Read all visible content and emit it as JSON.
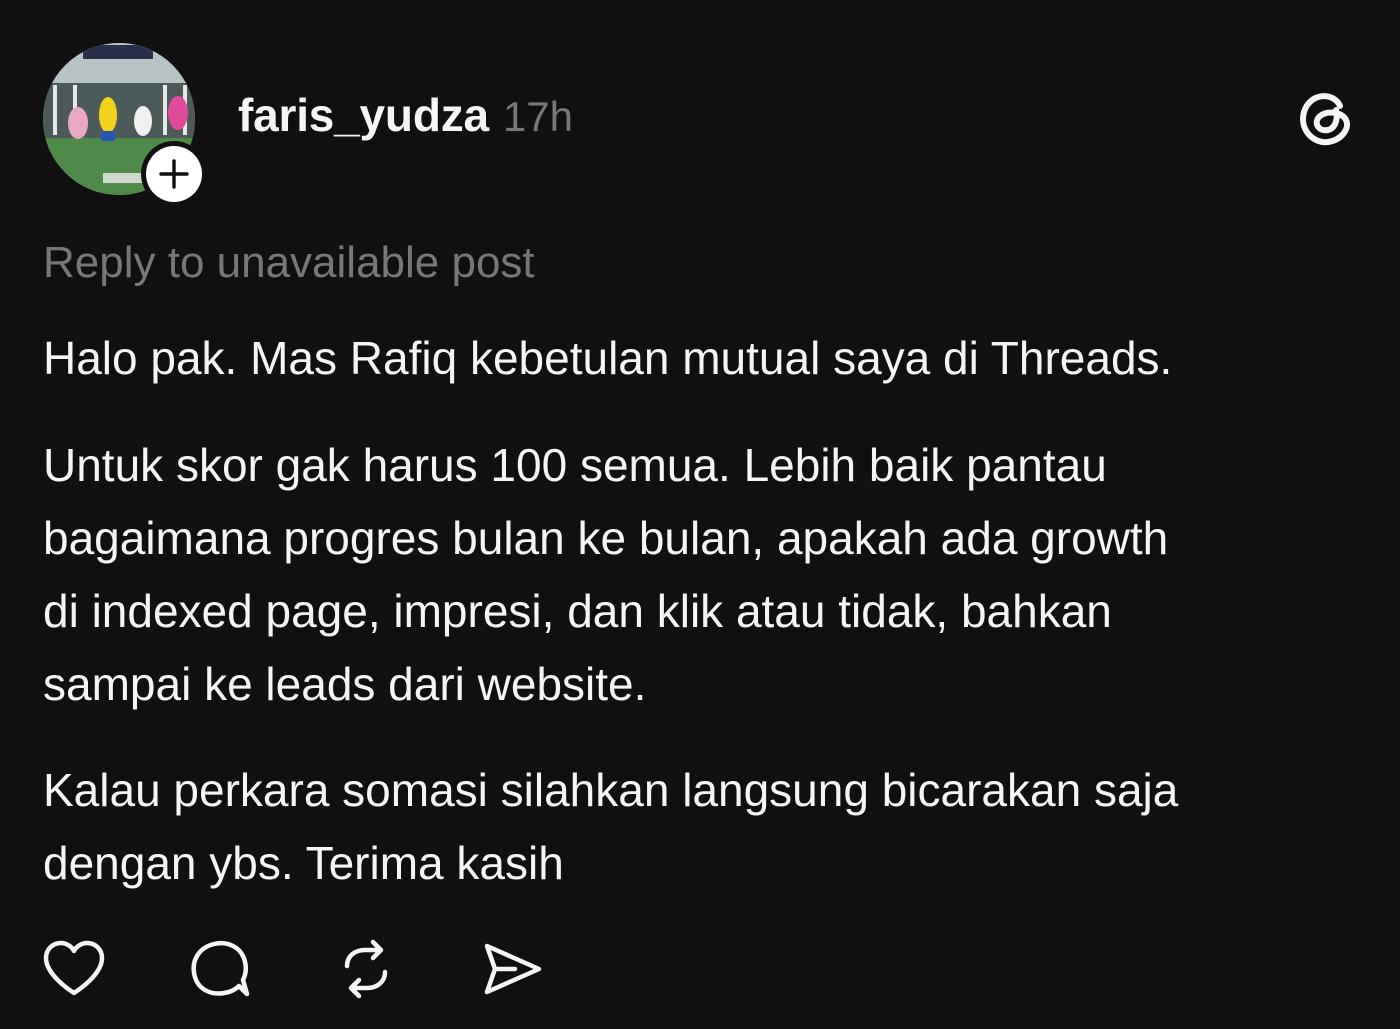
{
  "post": {
    "author": {
      "username": "faris_yudza",
      "avatar_icon": "avatar-photo",
      "follow_icon": "plus-icon"
    },
    "timestamp": "17h",
    "brand_icon": "threads-logo-icon",
    "reply_context": "Reply to unavailable post",
    "paragraphs": [
      [
        "Halo pak. Mas Rafiq kebetulan mutual saya di Threads."
      ],
      [
        "Untuk skor gak harus 100 semua. Lebih baik pantau",
        "bagaimana progres bulan ke bulan, apakah ada growth",
        "di indexed page, impresi, dan klik atau tidak, bahkan",
        "sampai ke leads dari website."
      ],
      [
        "Kalau perkara somasi silahkan langsung bicarakan saja",
        "dengan ybs. Terima kasih"
      ]
    ],
    "actions": [
      {
        "name": "like",
        "icon": "heart-icon"
      },
      {
        "name": "reply",
        "icon": "comment-icon"
      },
      {
        "name": "repost",
        "icon": "repost-icon"
      },
      {
        "name": "share",
        "icon": "send-icon"
      }
    ]
  },
  "colors": {
    "background": "#101010",
    "text_primary": "#f3f5f7",
    "text_secondary": "#777777"
  }
}
